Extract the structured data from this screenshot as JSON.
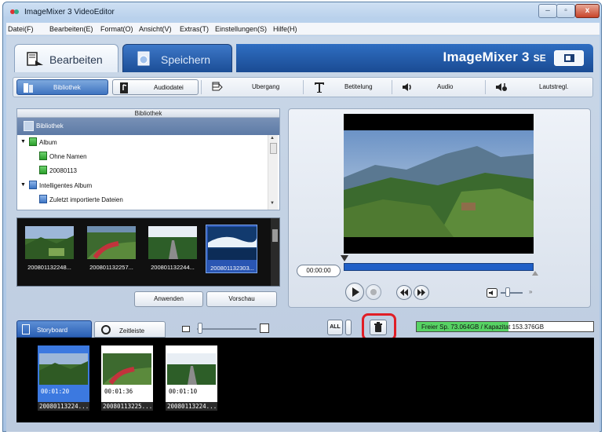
{
  "window": {
    "title": "ImageMixer 3 VideoEditor",
    "controls": [
      "–",
      "▫",
      "x"
    ]
  },
  "menu": [
    "Datei(F)",
    "Bearbeiten(E)",
    "Format(O)",
    "Ansicht(V)",
    "Extras(T)",
    "Einstellungen(S)",
    "Hilfe(H)"
  ],
  "main_tabs": {
    "edit": "Bearbeiten",
    "save": "Speichern",
    "brand": "ImageMixer 3",
    "brand_suffix": "SE"
  },
  "toolbar": [
    {
      "label": "Bibliothek",
      "icon": "library-icon",
      "active": true
    },
    {
      "label": "Audiodatei",
      "icon": "audio-file-icon"
    },
    {
      "label": "Ubergang",
      "icon": "transition-icon"
    },
    {
      "label": "Betitelung",
      "icon": "title-text-icon"
    },
    {
      "label": "Audio",
      "icon": "speaker-icon"
    },
    {
      "label": "Lautstregl.",
      "icon": "volume-control-icon"
    }
  ],
  "library": {
    "header": "Bibliothek",
    "root": "Bibliothek",
    "tree": [
      {
        "label": "Album",
        "level": 0,
        "expanded": true,
        "icon": "album-icon"
      },
      {
        "label": "Ohne Namen",
        "level": 1,
        "icon": "album-icon"
      },
      {
        "label": "20080113",
        "level": 1,
        "icon": "album-icon"
      },
      {
        "label": "Intelligentes Album",
        "level": 0,
        "expanded": true,
        "icon": "smart-album-icon"
      },
      {
        "label": "Zuletzt importierte Dateien",
        "level": 1,
        "icon": "smart-album-icon"
      }
    ]
  },
  "thumbnails": [
    {
      "caption": "200801132248...",
      "scene": "valley"
    },
    {
      "caption": "200801132257...",
      "scene": "flowers"
    },
    {
      "caption": "200801132244...",
      "scene": "road"
    },
    {
      "caption": "200801132303...",
      "scene": "waves",
      "selected": true
    }
  ],
  "buttons": {
    "apply": "Anwenden",
    "preview": "Vorschau"
  },
  "preview": {
    "timecode": "00:00:00",
    "progress": 0.0
  },
  "storyboard": {
    "tab_storyboard": "Storyboard",
    "tab_timeline": "Zeitleiste",
    "all_button": "ALL",
    "capacity_text": "Freier Sp. 73.064GB / Kapazitat 153.376GB",
    "capacity_used_fraction": 0.52,
    "clips": [
      {
        "time": "00:01:20",
        "name": "20080113224...",
        "scene": "valley",
        "selected": true
      },
      {
        "time": "00:01:36",
        "name": "20080113225...",
        "scene": "flowers"
      },
      {
        "time": "00:01:10",
        "name": "20080113224...",
        "scene": "road"
      }
    ]
  },
  "colors": {
    "accent_blue": "#2a5fb4",
    "highlight_red": "#e01e26",
    "capacity_green": "#57d364"
  }
}
